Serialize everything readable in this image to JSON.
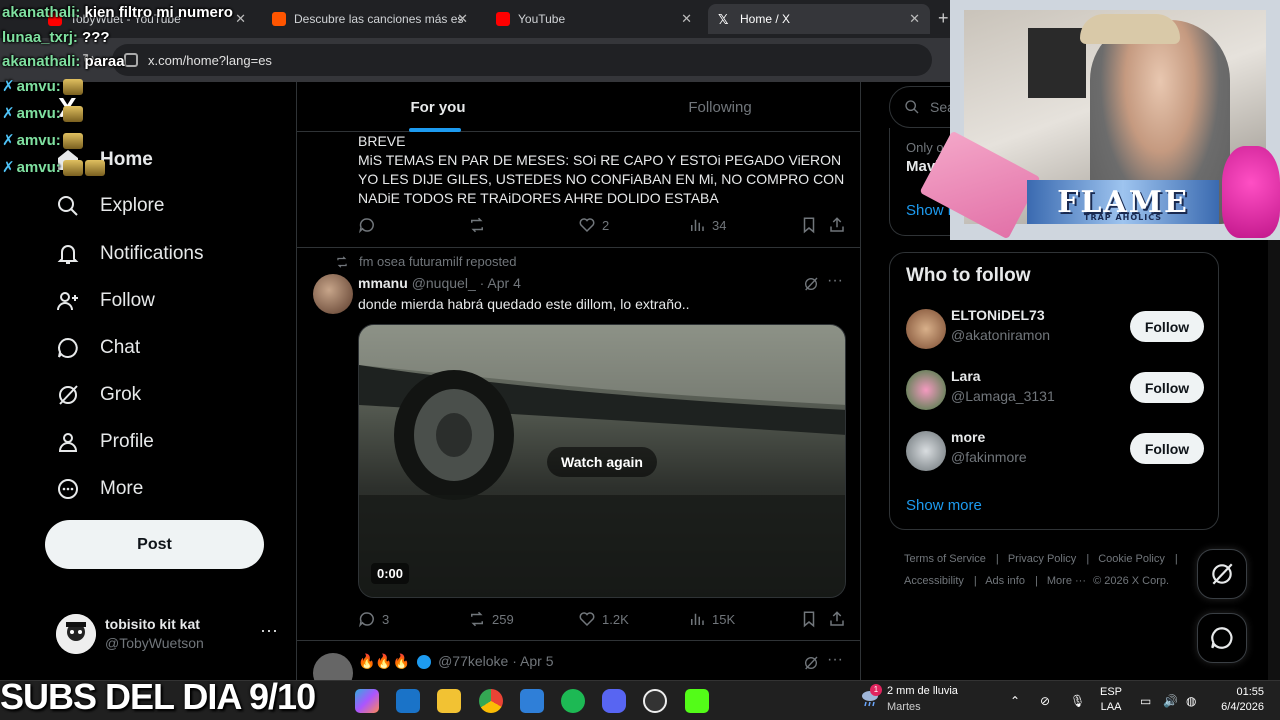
{
  "browser": {
    "tabs": [
      {
        "label": "TobyWuet - YouTube",
        "favicon_color": "#ff0000"
      },
      {
        "label": "Descubre las canciones más es",
        "favicon_color": "#ff5500"
      },
      {
        "label": "YouTube",
        "favicon_color": "#ff0000"
      },
      {
        "label": "Home / X",
        "favicon_color": "#ffffff"
      }
    ],
    "url": "x.com/home?lang=es"
  },
  "nav": {
    "logo": "X",
    "items": [
      {
        "label": "Home",
        "icon": "home-icon"
      },
      {
        "label": "Explore",
        "icon": "search-icon"
      },
      {
        "label": "Notifications",
        "icon": "bell-icon"
      },
      {
        "label": "Follow",
        "icon": "follow-icon"
      },
      {
        "label": "Chat",
        "icon": "chat-icon"
      },
      {
        "label": "Grok",
        "icon": "grok-icon"
      },
      {
        "label": "Profile",
        "icon": "profile-icon"
      },
      {
        "label": "More",
        "icon": "more-circle-icon"
      }
    ],
    "post_label": "Post",
    "account": {
      "name": "tobisito kit kat",
      "handle": "@TobyWuetson"
    }
  },
  "feed": {
    "tabs": [
      "For you",
      "Following"
    ],
    "tweet1": {
      "text": "BREVE\nMiS TEMAS EN PAR DE MESES: SOi RE CAPO Y ESTOi PEGADO ViERON YO LES DIJE GILES, USTEDES NO CONFiABAN EN Mi, NO COMPRO CON NADiE TODOS RE TRAiDORES AHRE DOLIDO ESTABA",
      "replies": "",
      "reposts": "",
      "likes": "2",
      "views": "34"
    },
    "tweet2": {
      "reposted_by": "fm osea futuramilf reposted",
      "name": "mmanu",
      "handle": "@nuquel_",
      "date": "· Apr 4",
      "text": "donde mierda habrá quedado este dillom, lo extraño..",
      "video_overlay": "Watch again",
      "video_time": "0:00",
      "replies": "3",
      "reposts": "259",
      "likes": "1.2K",
      "views": "15K"
    },
    "tweet3": {
      "name": "🔥🔥🔥",
      "handle": "@77keloke",
      "date": "· Apr 5"
    }
  },
  "sidebar": {
    "search_placeholder": "Search",
    "promo": {
      "sub": "Only on X",
      "title": "Mavi",
      "show_more": "Show more"
    },
    "who_to_follow": {
      "title": "Who to follow",
      "users": [
        {
          "name": "ELTONiDEL73",
          "handle": "@akatoniramon",
          "button": "Follow",
          "avatar_color": "#b07a5a"
        },
        {
          "name": "Lara",
          "handle": "@Lamaga_3131",
          "button": "Follow",
          "avatar_color": "#d85a8a"
        },
        {
          "name": "more",
          "handle": "@fakinmore",
          "button": "Follow",
          "avatar_color": "#9aa3a8"
        }
      ],
      "show_more": "Show more"
    },
    "footer": [
      "Terms of Service",
      "Privacy Policy",
      "Cookie Policy",
      "Accessibility",
      "Ads info",
      "More ···",
      "© 2026 X Corp."
    ]
  },
  "stream": {
    "chat": [
      {
        "user": "akanathali:",
        "msg": "kien filtro mi numero"
      },
      {
        "user": "lunaa_txrj:",
        "msg": "???"
      },
      {
        "user": "akanathali:",
        "msg": "paraa"
      },
      {
        "user": "amvu:",
        "msg": ""
      },
      {
        "user": "amvu:",
        "msg": ""
      },
      {
        "user": "amvu:",
        "msg": ""
      },
      {
        "user": "amvu:",
        "msg": ""
      }
    ],
    "cam_banner": "FLAME",
    "cam_banner_sub": "TRAP AHOLICS",
    "subs_text": "SUBS DEL DIA 9/10"
  },
  "taskbar": {
    "weather": {
      "line1": "2 mm de lluvia",
      "line2": "Martes",
      "badge": "1"
    },
    "lang": {
      "line1": "ESP",
      "line2": "LAA"
    },
    "clock": {
      "time": "01:55",
      "date": "6/4/2026"
    }
  }
}
